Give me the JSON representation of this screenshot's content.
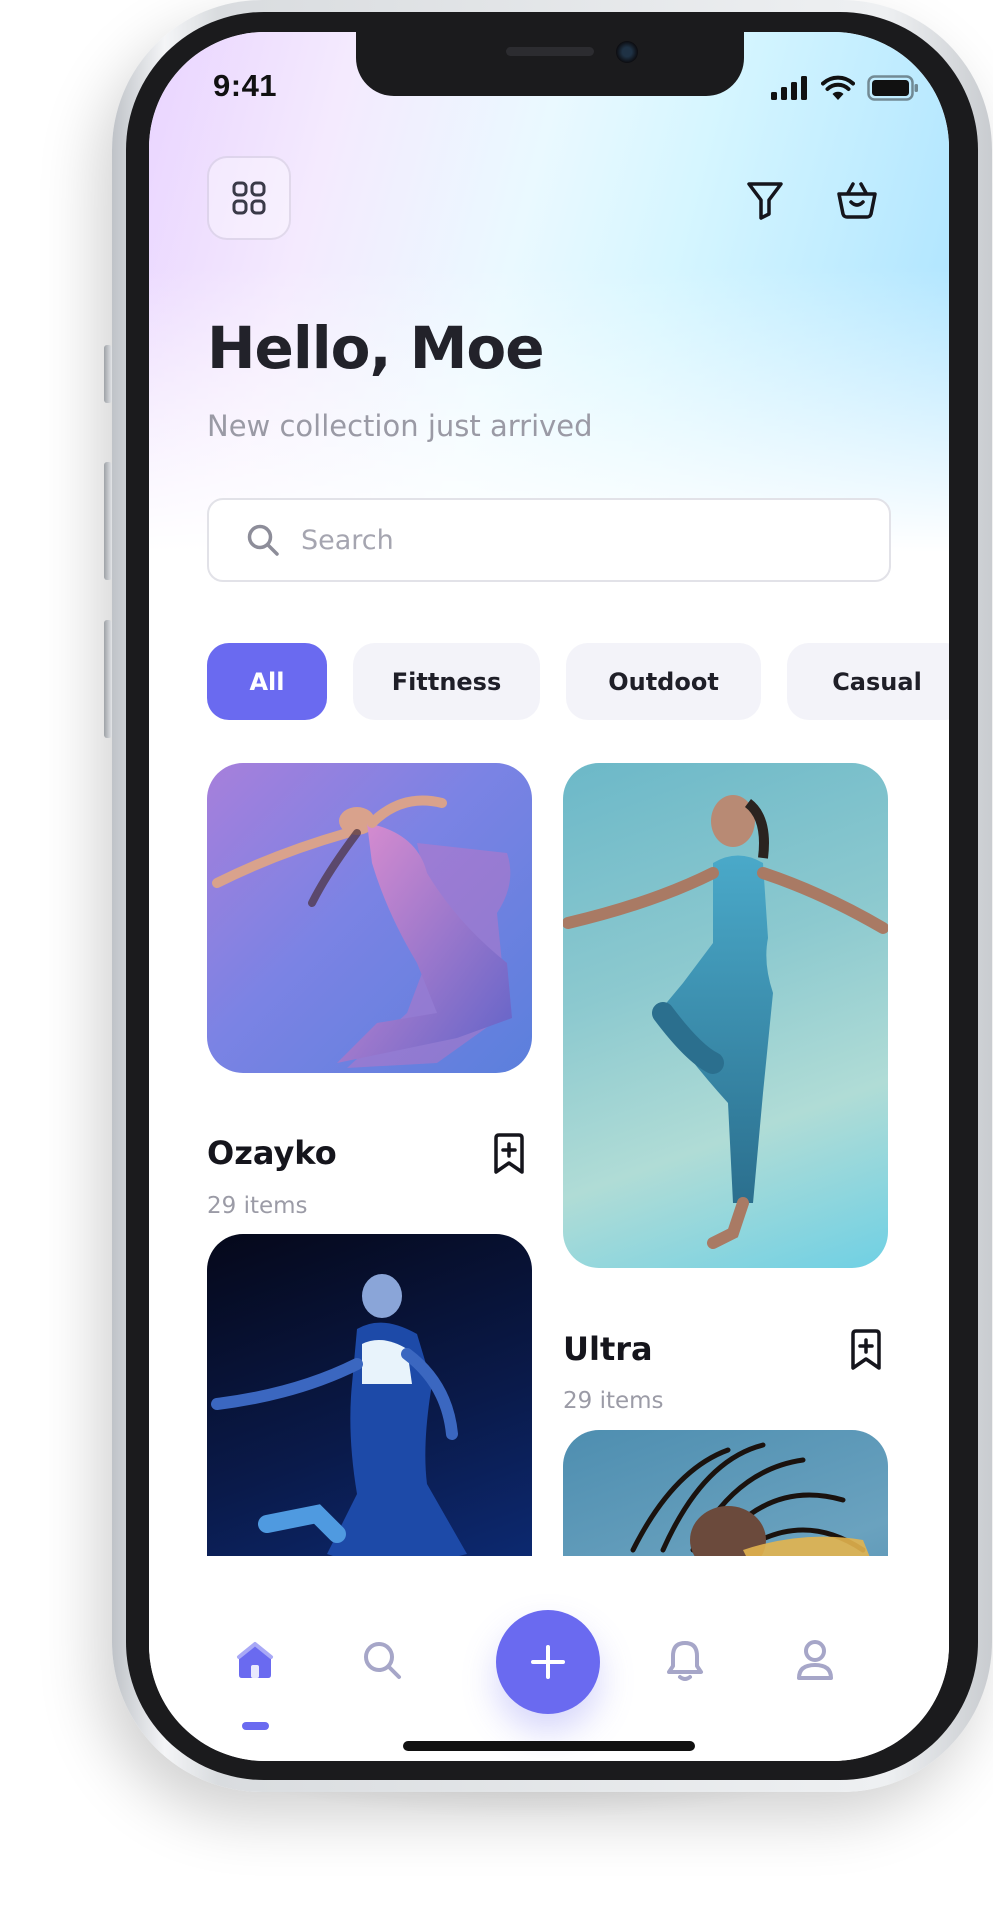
{
  "status_bar": {
    "time": "9:41"
  },
  "header": {
    "greeting": "Hello, Moe",
    "subtitle": "New collection just arrived"
  },
  "search": {
    "placeholder": "Search",
    "value": ""
  },
  "categories": [
    "All",
    "Fittness",
    "Outdoot",
    "Casual"
  ],
  "active_category": "All",
  "collections": [
    {
      "title": "Ozayko",
      "count": "29 items"
    },
    {
      "title": "Ultra",
      "count": "29 items"
    }
  ],
  "icons": {
    "menu": "grid-icon",
    "filter": "filter-icon",
    "cart": "basket-icon",
    "bookmark": "bookmark-plus-icon",
    "tab_home": "home-icon",
    "tab_search": "search-icon",
    "tab_add": "plus-icon",
    "tab_notifications": "bell-icon",
    "tab_profile": "user-icon"
  },
  "colors": {
    "accent": "#6A6AF0",
    "text": "#22222A",
    "muted": "#9A9AA5",
    "chip_bg": "#F3F3F9",
    "tab_inactive": "#A6A6C8"
  }
}
